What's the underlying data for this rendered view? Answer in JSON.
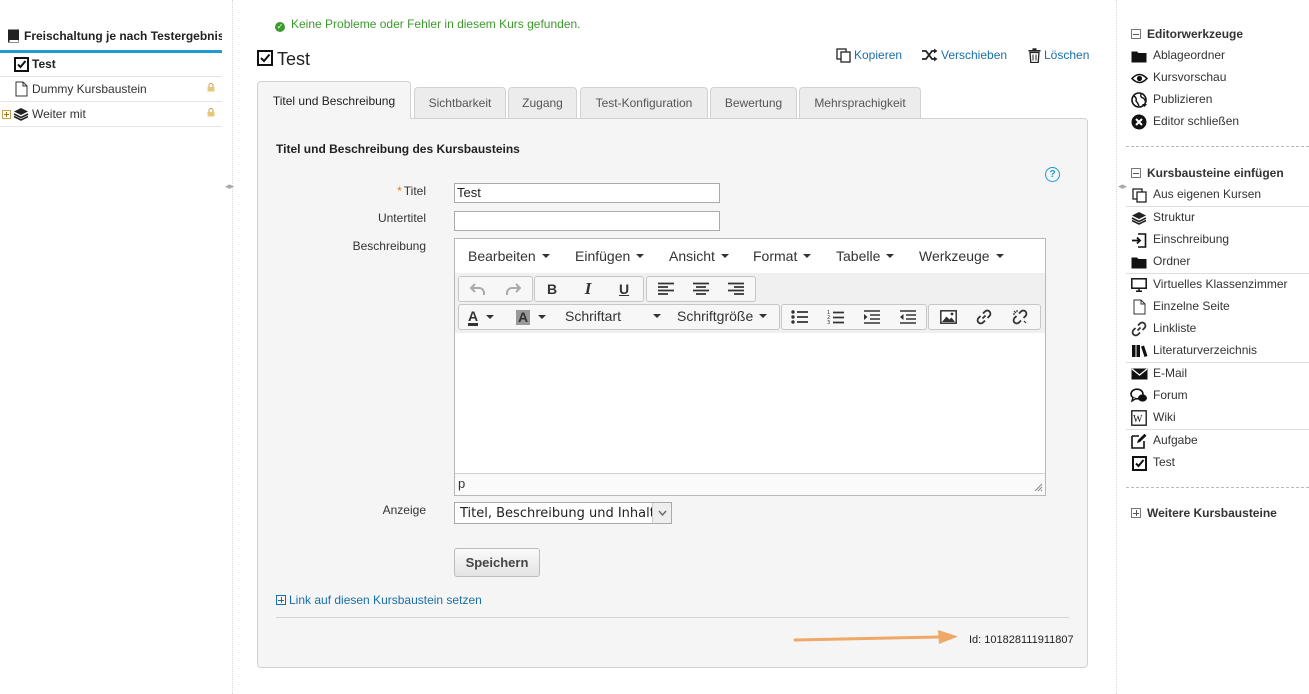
{
  "tree": {
    "root_label": "Freischaltung je nach Testergebnis",
    "items": [
      {
        "label": "Test",
        "icon": "checkbox-icon",
        "bold": true
      },
      {
        "label": "Dummy Kursbaustein",
        "icon": "page-icon"
      },
      {
        "label": "Weiter mit",
        "icon": "layers-icon"
      }
    ]
  },
  "status_message": "Keine Probleme oder Fehler in diesem Kurs gefunden.",
  "node": {
    "title": "Test",
    "actions": {
      "copy": "Kopieren",
      "move": "Verschieben",
      "delete": "Löschen"
    }
  },
  "tabs": [
    {
      "label": "Titel und Beschreibung",
      "active": true
    },
    {
      "label": "Sichtbarkeit"
    },
    {
      "label": "Zugang"
    },
    {
      "label": "Test-Konfiguration"
    },
    {
      "label": "Bewertung"
    },
    {
      "label": "Mehrsprachigkeit"
    }
  ],
  "form": {
    "section_title": "Titel und Beschreibung des Kursbausteins",
    "required_marker": "*",
    "title_label": "Titel",
    "title_value": "Test",
    "subtitle_label": "Untertitel",
    "subtitle_value": "",
    "description_label": "Beschreibung",
    "display_label": "Anzeige",
    "display_value": "Titel, Beschreibung und Inhalt",
    "save_label": "Speichern",
    "link_label": "Link auf diesen Kursbaustein setzen",
    "id_text": "Id: 101828111911807"
  },
  "editor": {
    "menus": [
      "Bearbeiten",
      "Einfügen",
      "Ansicht",
      "Format",
      "Tabelle",
      "Werkzeuge"
    ],
    "bold": "B",
    "italic": "I",
    "underline": "U",
    "font_color": "A",
    "bg_color": "A",
    "font_family": "Schriftart",
    "font_size": "Schriftgröße",
    "status_path": "p"
  },
  "right": {
    "editor_tools_title": "Editorwerkzeuge",
    "editor_tools": [
      "Ablageordner",
      "Kursvorschau",
      "Publizieren",
      "Editor schließen"
    ],
    "insert_title": "Kursbausteine einfügen",
    "insert_items": [
      "Aus eigenen Kursen",
      "Struktur",
      "Einschreibung",
      "Ordner",
      "Virtuelles Klassenzimmer",
      "Einzelne Seite",
      "Linkliste",
      "Literaturverzeichnis",
      "E-Mail",
      "Forum",
      "Wiki",
      "Aufgabe",
      "Test"
    ],
    "more_title": "Weitere Kursbausteine"
  },
  "colors": {
    "accent": "#1f9bcf",
    "link": "#1a6ea8",
    "success": "#3d9a2c",
    "required": "#e8731a",
    "arrow": "#f0a868"
  }
}
